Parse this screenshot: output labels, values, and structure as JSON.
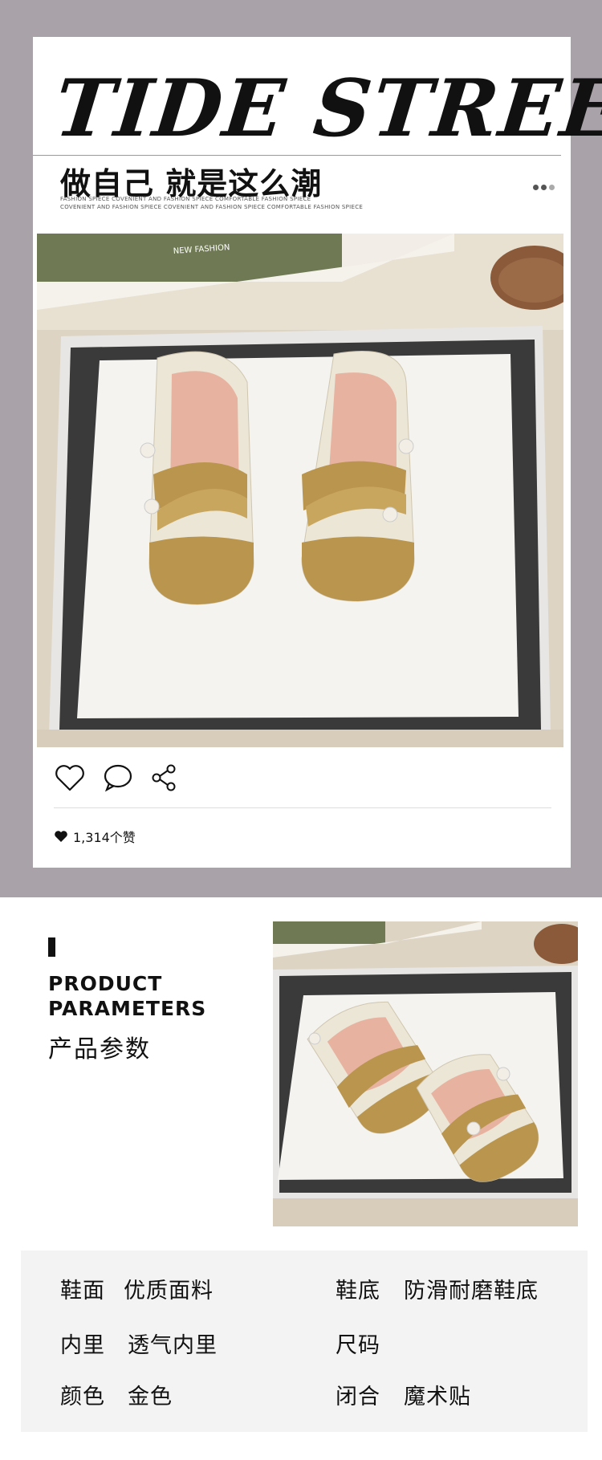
{
  "header": {
    "brand": "TIDE STREET",
    "slogan": "做自己 就是这么潮",
    "fine_print_1": "FASHION SPIECE COVENIENT AND FASHION SPIECE COMFORTABLE FASHION SPIECE",
    "fine_print_2": "COVENIENT AND FASHION SPIECE COVENIENT AND FASHION SPIECE COMFORTABLE FASHION SPIECE"
  },
  "photo_text": "NEW FASHION",
  "social": {
    "likes": "1,314个赞"
  },
  "parameters": {
    "title_en_1": "PRODUCT",
    "title_en_2": "PARAMETERS",
    "title_cn": "产品参数",
    "rows": [
      {
        "label": "鞋面",
        "value": "优质面料"
      },
      {
        "label": "鞋底",
        "value": "防滑耐磨鞋底"
      },
      {
        "label": "内里",
        "value": "透气内里"
      },
      {
        "label": "尺码",
        "value": ""
      },
      {
        "label": "颜色",
        "value": "金色"
      },
      {
        "label": "闭合",
        "value": "魔术贴"
      }
    ]
  },
  "colors": {
    "hero_bg": "#a9a2a8",
    "accent_gold": "#b9954e",
    "shoe_cream": "#ece6d6"
  }
}
